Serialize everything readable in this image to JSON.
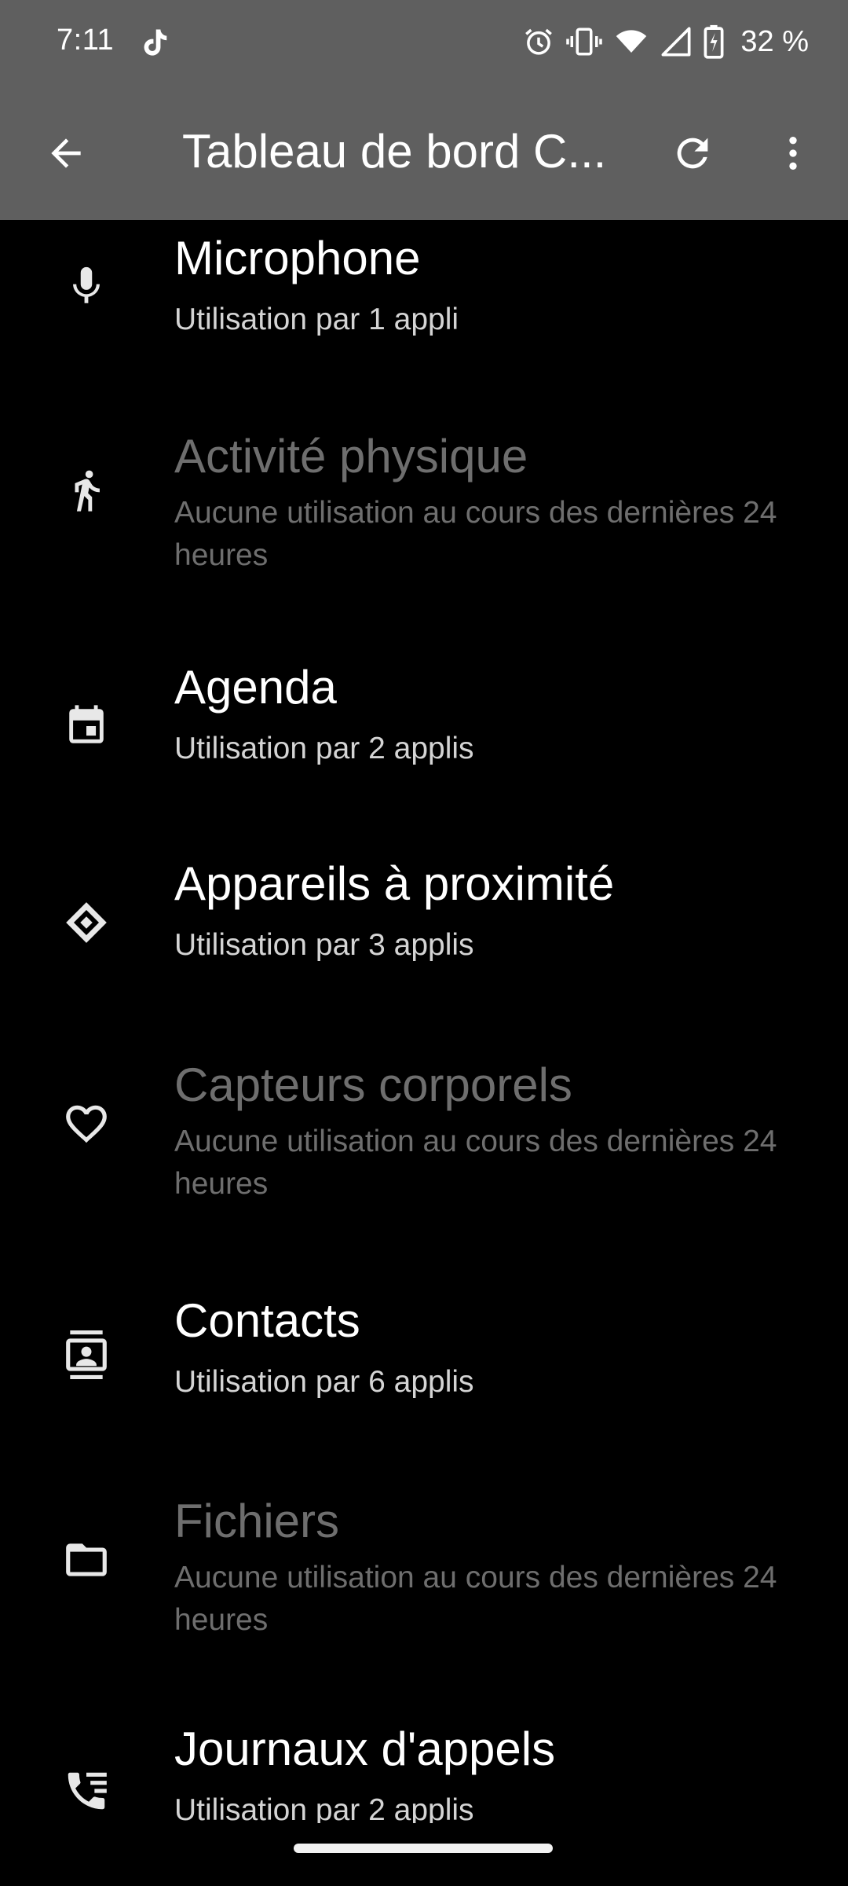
{
  "status_bar": {
    "time": "7:11",
    "battery_text": "32 %",
    "icons": [
      "tiktok-icon",
      "alarm-icon",
      "vibrate-icon",
      "wifi-icon",
      "signal-icon",
      "battery-charging-icon"
    ]
  },
  "app_bar": {
    "title": "Tableau de bord C...",
    "back_icon": "arrow-back-icon",
    "refresh_icon": "refresh-icon",
    "more_icon": "more-vert-icon"
  },
  "colors": {
    "status_bar_bg": "#5f5f5f",
    "background": "#000000",
    "text_primary": "#ffffff",
    "text_secondary": "#d4d4d4",
    "text_disabled": "#6e6e6e"
  },
  "permissions": [
    {
      "icon": "microphone-icon",
      "title": "Microphone",
      "subtitle": "Utilisation par 1 appli",
      "enabled": true
    },
    {
      "icon": "running-person-icon",
      "title": "Activité physique",
      "subtitle": "Aucune utilisation au cours des dernières 24 heures",
      "enabled": false
    },
    {
      "icon": "calendar-icon",
      "title": "Agenda",
      "subtitle": "Utilisation par 2 applis",
      "enabled": true
    },
    {
      "icon": "nearby-devices-icon",
      "title": "Appareils à proximité",
      "subtitle": "Utilisation par 3 applis",
      "enabled": true
    },
    {
      "icon": "heart-icon",
      "title": "Capteurs corporels",
      "subtitle": "Aucune utilisation au cours des dernières 24 heures",
      "enabled": false
    },
    {
      "icon": "contacts-icon",
      "title": "Contacts",
      "subtitle": "Utilisation par 6 applis",
      "enabled": true
    },
    {
      "icon": "folder-icon",
      "title": "Fichiers",
      "subtitle": "Aucune utilisation au cours des dernières 24 heures",
      "enabled": false
    },
    {
      "icon": "call-log-icon",
      "title": "Journaux d'appels",
      "subtitle": "Utilisation par 2 applis",
      "enabled": true
    }
  ]
}
